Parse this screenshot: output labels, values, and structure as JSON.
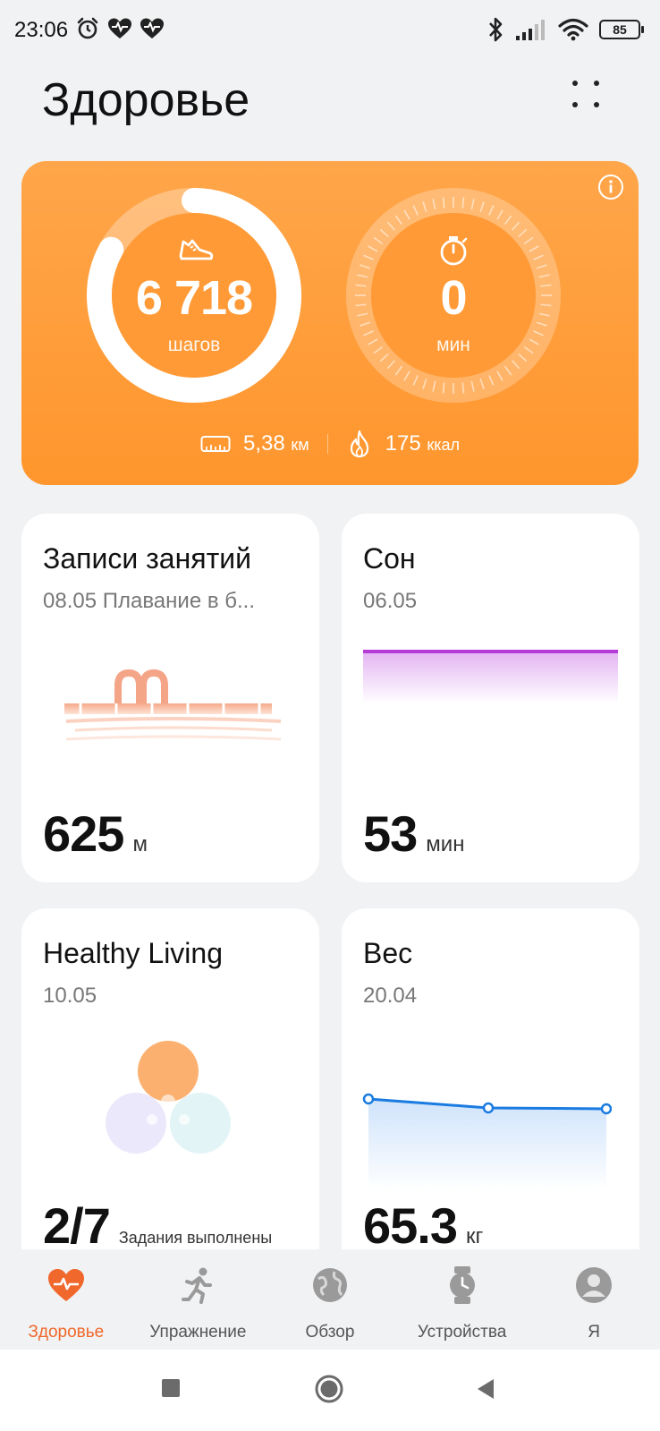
{
  "status_bar": {
    "time": "23:06",
    "left_icons": [
      "alarm-icon",
      "heart-rate-icon",
      "heart-rate-icon"
    ],
    "right_icons": [
      "bluetooth-icon",
      "signal-icon",
      "wifi-icon"
    ],
    "battery": "85"
  },
  "header": {
    "title": "Здоровье"
  },
  "activity": {
    "steps_value": "6 718",
    "steps_label": "шагов",
    "steps_progress": 0.83,
    "minutes_value": "0",
    "minutes_label": "мин",
    "distance_value": "5,38",
    "distance_unit": "км",
    "calories_value": "175",
    "calories_unit": "ккал",
    "accent_color": "#ff9a36"
  },
  "tiles": {
    "workouts": {
      "title": "Записи занятий",
      "subtitle": "08.05 Плавание в б...",
      "value": "625",
      "unit": "м"
    },
    "sleep": {
      "title": "Сон",
      "subtitle": "06.05",
      "value": "53",
      "unit": "мин",
      "color": "#b53ad8"
    },
    "healthy_living": {
      "title": "Healthy Living",
      "subtitle": "10.05",
      "value": "2/7",
      "unit": "Задания выполнены"
    },
    "weight": {
      "title": "Вес",
      "subtitle": "20.04",
      "value": "65.3",
      "unit": "кг",
      "color": "#1a7be0"
    }
  },
  "bottom_nav": {
    "items": [
      {
        "label": "Здоровье",
        "icon": "heart-icon",
        "active": true
      },
      {
        "label": "Упражнение",
        "icon": "running-icon",
        "active": false
      },
      {
        "label": "Обзор",
        "icon": "globe-icon",
        "active": false
      },
      {
        "label": "Устройства",
        "icon": "watch-icon",
        "active": false
      },
      {
        "label": "Я",
        "icon": "user-icon",
        "active": false
      }
    ],
    "active_color": "#f0682b"
  },
  "system_nav": [
    "recents-button",
    "home-button",
    "back-button"
  ]
}
